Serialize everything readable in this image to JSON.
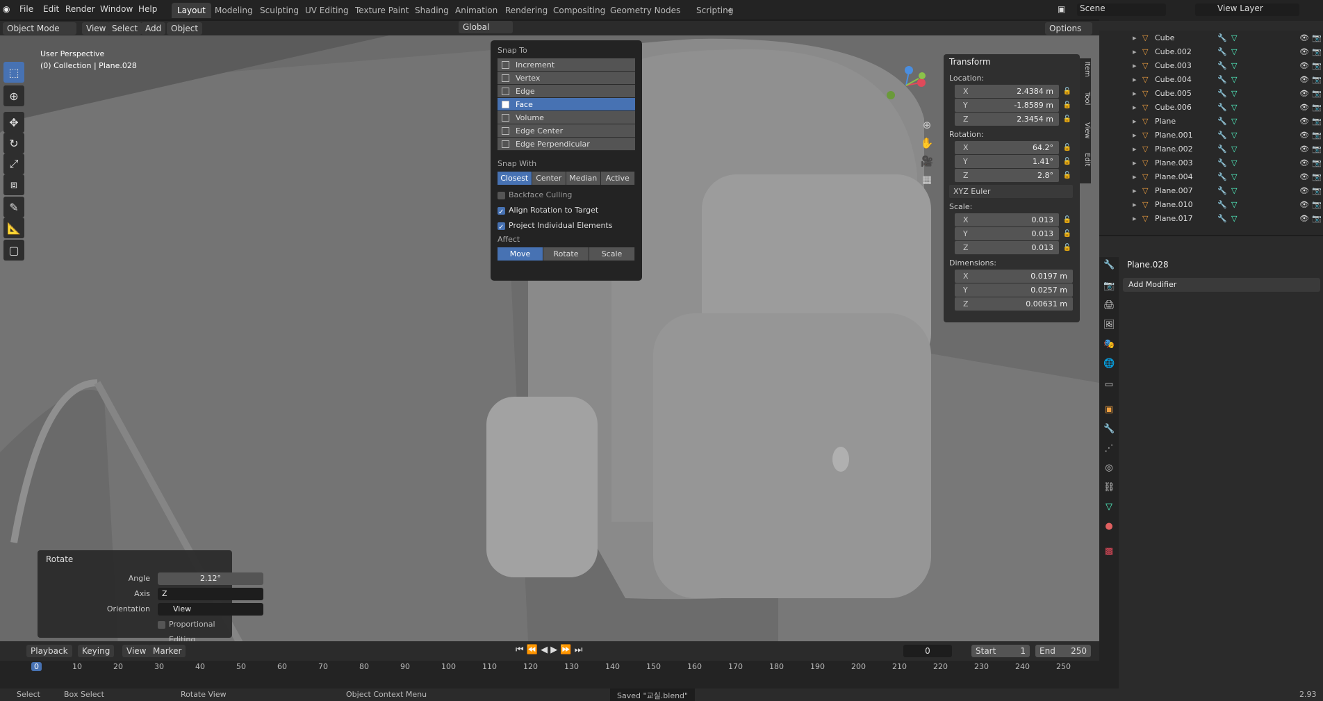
{
  "topbar": {
    "menus": [
      "File",
      "Edit",
      "Render",
      "Window",
      "Help"
    ],
    "workspaces": [
      "Layout",
      "Modeling",
      "Sculpting",
      "UV Editing",
      "Texture Paint",
      "Shading",
      "Animation",
      "Rendering",
      "Compositing",
      "Geometry Nodes",
      "Scripting"
    ],
    "active_workspace": "Layout",
    "scene": "Scene",
    "view_layer": "View Layer"
  },
  "header": {
    "mode": "Object Mode",
    "menus": [
      "View",
      "Select",
      "Add",
      "Object"
    ],
    "transform_orientation": "Global",
    "options": "Options"
  },
  "viewport": {
    "perspective": "User Perspective",
    "collection": "(0) Collection | Plane.028"
  },
  "snap_popup": {
    "snap_to_title": "Snap To",
    "snap_to": [
      "Increment",
      "Vertex",
      "Edge",
      "Face",
      "Volume",
      "Edge Center",
      "Edge Perpendicular"
    ],
    "snap_to_selected": "Face",
    "snap_with_title": "Snap With",
    "snap_with": [
      "Closest",
      "Center",
      "Median",
      "Active"
    ],
    "snap_with_selected": "Closest",
    "backface": "Backface Culling",
    "align_rotation": "Align Rotation to Target",
    "project_individual": "Project Individual Elements",
    "affect_title": "Affect",
    "affect": [
      "Move",
      "Rotate",
      "Scale"
    ],
    "affect_selected": "Move"
  },
  "transform": {
    "title": "Transform",
    "location_label": "Location:",
    "location": [
      {
        "axis": "X",
        "value": "2.4384 m"
      },
      {
        "axis": "Y",
        "value": "-1.8589 m"
      },
      {
        "axis": "Z",
        "value": "2.3454 m"
      }
    ],
    "rotation_label": "Rotation:",
    "rotation": [
      {
        "axis": "X",
        "value": "64.2°"
      },
      {
        "axis": "Y",
        "value": "1.41°"
      },
      {
        "axis": "Z",
        "value": "2.8°"
      }
    ],
    "rotation_mode": "XYZ Euler",
    "scale_label": "Scale:",
    "scale": [
      {
        "axis": "X",
        "value": "0.013"
      },
      {
        "axis": "Y",
        "value": "0.013"
      },
      {
        "axis": "Z",
        "value": "0.013"
      }
    ],
    "dimensions_label": "Dimensions:",
    "dimensions": [
      {
        "axis": "X",
        "value": "0.0197 m"
      },
      {
        "axis": "Y",
        "value": "0.0257 m"
      },
      {
        "axis": "Z",
        "value": "0.00631 m"
      }
    ]
  },
  "npanel_tabs": [
    "Item",
    "Tool",
    "View",
    "Edit"
  ],
  "rotate_panel": {
    "title": "Rotate",
    "angle_label": "Angle",
    "angle": "2.12°",
    "axis_label": "Axis",
    "axis": "Z",
    "orientation_label": "Orientation",
    "orientation": "View",
    "proportional": "Proportional Editing"
  },
  "timeline": {
    "menus": [
      "Playback",
      "Keying",
      "View",
      "Marker"
    ],
    "current_frame": "0",
    "start_label": "Start",
    "start": "1",
    "end_label": "End",
    "end": "250",
    "ticks": [
      "0",
      "10",
      "20",
      "30",
      "40",
      "50",
      "60",
      "70",
      "80",
      "90",
      "100",
      "110",
      "120",
      "130",
      "140",
      "150",
      "160",
      "170",
      "180",
      "190",
      "200",
      "210",
      "220",
      "230",
      "240",
      "250"
    ]
  },
  "outliner": {
    "items": [
      "Cube",
      "Cube.002",
      "Cube.003",
      "Cube.004",
      "Cube.005",
      "Cube.006",
      "Plane",
      "Plane.001",
      "Plane.002",
      "Plane.003",
      "Plane.004",
      "Plane.007",
      "Plane.010",
      "Plane.017"
    ]
  },
  "properties": {
    "object": "Plane.028",
    "add_modifier": "Add Modifier"
  },
  "statusbar": {
    "select": "Select",
    "box_select": "Box Select",
    "rotate_view": "Rotate View",
    "context_menu": "Object Context Menu",
    "saved": "Saved \"교실.blend\"",
    "version": "2.93"
  }
}
